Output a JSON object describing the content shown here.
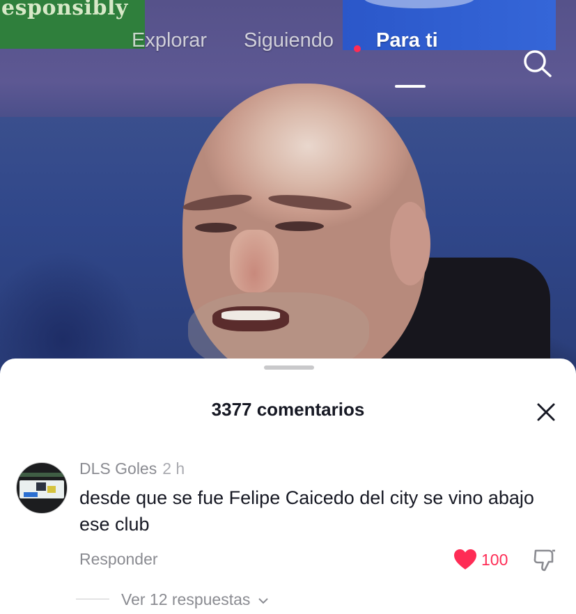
{
  "video": {
    "banner_text": "esponsibly"
  },
  "top_nav": {
    "tabs": [
      {
        "label": "Explorar"
      },
      {
        "label": "Siguiendo"
      },
      {
        "label": "Para ti"
      }
    ],
    "active_tab": "Para ti",
    "search_icon": "search-icon"
  },
  "comments": {
    "title": "3377 comentarios",
    "close_icon": "close-icon",
    "items": [
      {
        "author": "DLS Goles",
        "time": "2 h",
        "text": "desde que se fue Felipe Caicedo del city se vino abajo ese club",
        "reply_label": "Responder",
        "likes": "100",
        "view_replies_label": "Ver 12 respuestas"
      }
    ]
  },
  "colors": {
    "accent": "#fe2c55",
    "text_primary": "#161823",
    "text_secondary": "#8a8b91"
  }
}
